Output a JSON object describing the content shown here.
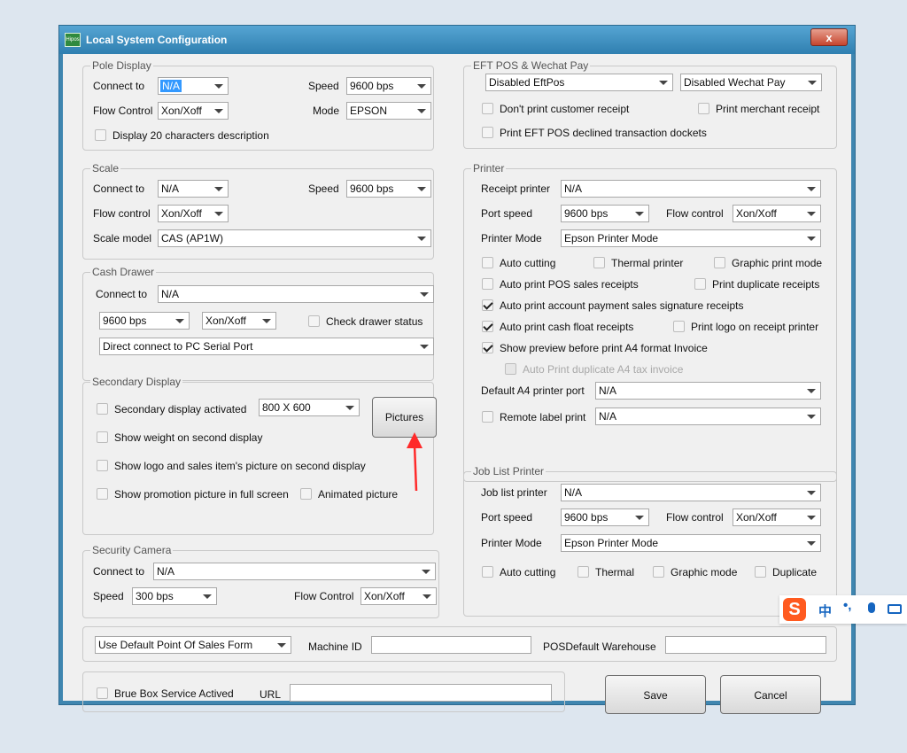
{
  "window": {
    "title": "Local System Configuration",
    "icon_text": "Hipos",
    "close_label": "x"
  },
  "pole": {
    "legend": "Pole Display",
    "connect_label": "Connect to",
    "connect_value": "N/A",
    "speed_label": "Speed",
    "speed_value": "9600 bps",
    "flow_label": "Flow Control",
    "flow_value": "Xon/Xoff",
    "mode_label": "Mode",
    "mode_value": "EPSON",
    "chk20": "Display 20 characters description"
  },
  "scale": {
    "legend": "Scale",
    "connect_label": "Connect to",
    "connect_value": "N/A",
    "speed_label": "Speed",
    "speed_value": "9600 bps",
    "flow_label": "Flow control",
    "flow_value": "Xon/Xoff",
    "model_label": "Scale model",
    "model_value": "CAS (AP1W)"
  },
  "drawer": {
    "legend": "Cash Drawer",
    "connect_label": "Connect to",
    "connect_value": "N/A",
    "speed_value": "9600 bps",
    "flow_value": "Xon/Xoff",
    "check_label": "Check drawer status",
    "direct_value": "Direct connect to PC Serial Port"
  },
  "secondary": {
    "legend": "Secondary Display",
    "activated": "Secondary display activated",
    "resolution": "800 X 600",
    "pictures_btn": "Pictures",
    "weight": "Show weight on second display",
    "logo": "Show logo and sales item's picture on second display",
    "promo": "Show promotion picture in full screen",
    "animated": "Animated picture"
  },
  "camera": {
    "legend": "Security Camera",
    "connect_label": "Connect to",
    "connect_value": "N/A",
    "speed_label": "Speed",
    "speed_value": "300 bps",
    "flow_label": "Flow Control",
    "flow_value": "Xon/Xoff"
  },
  "eft": {
    "legend": "EFT POS & Wechat Pay",
    "eftpos_value": "Disabled EftPos",
    "wechat_value": "Disabled Wechat Pay",
    "no_customer": "Don't print customer receipt",
    "merchant": "Print merchant receipt",
    "declined": "Print EFT POS declined transaction dockets"
  },
  "printer": {
    "legend": "Printer",
    "receipt_label": "Receipt printer",
    "receipt_value": "N/A",
    "port_label": "Port speed",
    "port_value": "9600 bps",
    "flow_label": "Flow control",
    "flow_value": "Xon/Xoff",
    "mode_label": "Printer Mode",
    "mode_value": "Epson Printer Mode",
    "auto_cut": "Auto cutting",
    "thermal": "Thermal printer",
    "graphic": "Graphic print mode",
    "auto_pos": "Auto print POS sales receipts",
    "duplicate": "Print duplicate receipts",
    "auto_account": "Auto print account payment sales signature receipts",
    "auto_float": "Auto print cash float receipts",
    "logo": "Print logo on receipt printer",
    "preview": "Show preview before print A4 format Invoice",
    "auto_dup_a4": "Auto Print duplicate A4 tax invoice",
    "a4_label": "Default A4 printer port",
    "a4_value": "N/A",
    "remote_label": "Remote label print",
    "remote_value": "N/A"
  },
  "joblist": {
    "legend": "Job List Printer",
    "printer_label": "Job list printer",
    "printer_value": "N/A",
    "port_label": "Port speed",
    "port_value": "9600 bps",
    "flow_label": "Flow control",
    "flow_value": "Xon/Xoff",
    "mode_label": "Printer Mode",
    "mode_value": "Epson Printer Mode",
    "auto_cut": "Auto cutting",
    "thermal": "Thermal",
    "graphic": "Graphic mode",
    "duplicate": "Duplicate"
  },
  "bottom": {
    "form_value": "Use Default Point Of Sales Form",
    "machine_label": "Machine ID",
    "machine_value": "",
    "warehouse_label": "POSDefault Warehouse",
    "warehouse_value": "",
    "brue_label": "Brue Box Service Actived",
    "url_label": "URL",
    "url_value": "",
    "save_btn": "Save",
    "cancel_btn": "Cancel"
  },
  "ime": {
    "logo": "S",
    "lang": "中",
    "punct": "•,"
  },
  "colors": {
    "titlebar": "#3a8cc0",
    "close": "#c6452f",
    "annotation_arrow": "#ff2a2a"
  }
}
